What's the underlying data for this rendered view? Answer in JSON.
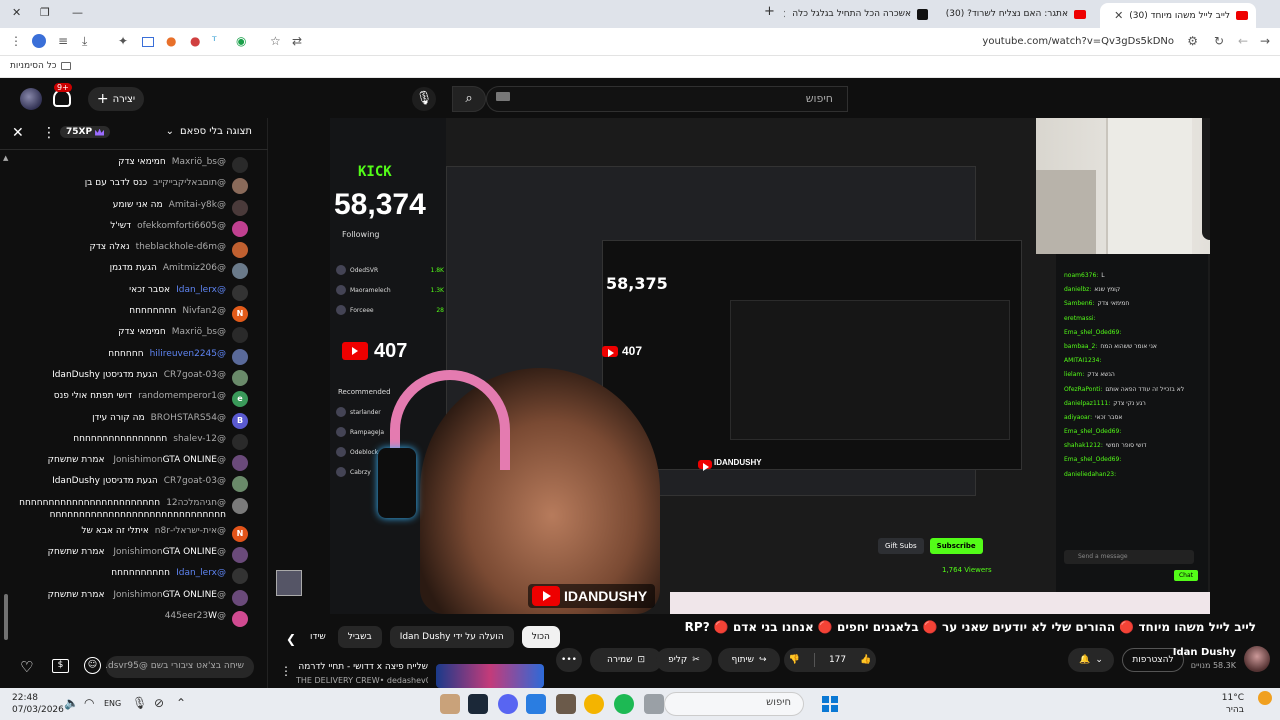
{
  "browser": {
    "tabs": [
      {
        "title": "לייב לייל משהו מיוחד (30)",
        "active": true
      },
      {
        "title": "אתגר: האם נצליח לשרוד? (30)",
        "active": false
      },
      {
        "title": "אשכרה הכל התחיל בגלגל כלה",
        "active": false
      }
    ],
    "new_tab": "+",
    "url": "youtube.com/watch?v=Qv3gDs5kDNo",
    "bookmarks_label": "כל הסימניות"
  },
  "masthead": {
    "create_label": "יצירה",
    "notif_count": "9+",
    "search_placeholder": "חיפוש"
  },
  "chat": {
    "mode_label": "תצוגה בלי ספאם",
    "xp_label": "75XP",
    "input_placeholder": "שיחה בצ'אט ציבורי בשם @dsvr95...",
    "messages": [
      {
        "author": "@Maxriö_bs",
        "text": "חמימאי צדק",
        "av": "#2a2a2a",
        "initial": "",
        "mod": false
      },
      {
        "author": "@תוםבאליקבייקייב",
        "text": "כנס לדבר עם בן",
        "av": "#8a6a5a",
        "initial": "",
        "mod": false
      },
      {
        "author": "@Amitai-y8k",
        "text": "מה אני שומע",
        "av": "#4a3a3a",
        "initial": "",
        "mod": false
      },
      {
        "author": "@ofekkomforti6605",
        "text": "דשי'ל",
        "av": "#c04090",
        "initial": "",
        "mod": false
      },
      {
        "author": "@theblackhole-d6m",
        "text": "נאלה צדק",
        "av": "#c06030",
        "initial": "",
        "mod": false
      },
      {
        "author": "@Amitmiz206",
        "text": "הגעת מדגמן",
        "av": "#6a7a8a",
        "initial": "",
        "mod": false
      },
      {
        "author": "@Idan_lerx",
        "text": "אסבר זכאי",
        "av": "#333",
        "initial": "",
        "mod": true
      },
      {
        "author": "@Nivfan2",
        "text": "חחחחחחחח",
        "av": "#e25b1a",
        "initial": "N",
        "mod": false
      },
      {
        "author": "@Maxriö_bs",
        "text": "חמימאי צדק",
        "av": "#2a2a2a",
        "initial": "",
        "mod": false
      },
      {
        "author": "@hilireuven2245",
        "text": "חחחחחח",
        "av": "#5a6a9a",
        "initial": "",
        "mod": true
      },
      {
        "author": "@CR7goat-03",
        "text": "הגעת מדגיסטן IdanDushy",
        "av": "#6a8a6a",
        "initial": "",
        "mod": false
      },
      {
        "author": "@randomemperor1",
        "text": "דושי תפתח אולי פנס",
        "av": "#3a9a5a",
        "initial": "e",
        "mod": false
      },
      {
        "author": "@BROHSTARS54",
        "text": "מה קורה עידן",
        "av": "#5a5ad0",
        "initial": "B",
        "mod": false
      },
      {
        "author": "@shalev-12",
        "text": "חחחחחחחחחחחחחחחח",
        "av": "#2a2a2a",
        "initial": "",
        "mod": false
      },
      {
        "author": "@Jonishimon",
        "text": "GTA ONLINE אמרת שתשחק",
        "av": "#6a4a7a",
        "initial": "",
        "mod": false
      },
      {
        "author": "@CR7goat-03",
        "text": "הגעת מדגיסטן IdanDushy",
        "av": "#6a8a6a",
        "initial": "",
        "mod": false
      },
      {
        "author": "@חגיהמלכה12",
        "text": "חחחחחחחחחחחחחחחחחחחחחחחחחחחחחחחחחחחחחחחחחחחחחחחחחחחחחח",
        "av": "#7a7a7a",
        "initial": "",
        "mod": false
      },
      {
        "author": "@אית-ישראלי-n8r",
        "text": "איתלי זה אבא של",
        "av": "#e2541a",
        "initial": "N",
        "mod": false
      },
      {
        "author": "@Jonishimon",
        "text": "GTA ONLINE אמרת שתשחק",
        "av": "#6a4a7a",
        "initial": "",
        "mod": false
      },
      {
        "author": "@Idan_lerx",
        "text": "חחחחחחחחחח",
        "av": "#333",
        "initial": "",
        "mod": true
      },
      {
        "author": "@Jonishimon",
        "text": "GTA ONLINE אמרת שתשחק",
        "av": "#6a4a7a",
        "initial": "",
        "mod": false
      },
      {
        "author": "@445eer23",
        "text": "W",
        "av": "#d04a90",
        "initial": "",
        "mod": false
      }
    ]
  },
  "stream": {
    "kick_logo": "KICK",
    "big_count": "58,374",
    "inner_count": "58,375",
    "yt_badge_count": "407",
    "yt_badge_count_inner": "407",
    "following_label": "Following",
    "follow_rows": [
      {
        "name": "OdedSVR",
        "count": "1.8K"
      },
      {
        "name": "Maoramelech",
        "count": "1.3K"
      },
      {
        "name": "Forceee",
        "count": "28"
      }
    ],
    "recommended_label": "Recommended",
    "rec_rows": [
      "starlander",
      "RampageJa",
      "Odeblock",
      "Cabrzy"
    ],
    "kick_chat": [
      {
        "u": "noam6376:",
        "t": "L"
      },
      {
        "u": "danielbz:",
        "t": "קומץ שנא"
      },
      {
        "u": "Samben6:",
        "t": "חמימאי צדק"
      },
      {
        "u": "eretmassi:",
        "t": ""
      },
      {
        "u": "Ema_shel_Oded69:",
        "t": ""
      },
      {
        "u": "bambaa_2:",
        "t": "אני אומר ששהוא המח"
      },
      {
        "u": "AMITAI1234:",
        "t": ""
      },
      {
        "u": "lielam:",
        "t": "הנשא צדק"
      },
      {
        "u": "OfezRaPonti:",
        "t": "לא בזכייל זה עודד הפאה אותם"
      },
      {
        "u": "danielpaz1111:",
        "t": "רגע נקי צדק"
      },
      {
        "u": "adiyaoar:",
        "t": "אסבר זכאי"
      },
      {
        "u": "Ema_shel_Oded69:",
        "t": ""
      },
      {
        "u": "shahak1212:",
        "t": "דושי סופר חמשי"
      },
      {
        "u": "Ema_shel_Oded69:",
        "t": ""
      },
      {
        "u": "danieliedahan23:",
        "t": ""
      }
    ],
    "kick_chat_placeholder": "Send a message",
    "kick_chat_button": "Chat",
    "subscribe_label": "Subscribe",
    "gift_label": "Gift Subs",
    "viewers_label": "1,764 Viewers",
    "watermark": "IDANDUSHY",
    "watermark_inner": "IDANDUSHY"
  },
  "below": {
    "chips": [
      "הכול",
      "הועלה על ידי Idan Dushy",
      "בשביל",
      "שידו"
    ],
    "next_title": "שלייח פיצה x דדושי - תחיי לדרמה 2",
    "next_channel": "THE DELIVERY CREW• dedashev02",
    "video_title": "לייב לייל משהו מיוחד 🔴 ההורים שלי לא יודעים שאני ער 🔴 בלאגנים יחפים 🔴 אנחנו בני אדם 🔴 ?RP",
    "channel_name": "Idan Dushy",
    "subscribers": "58.3K מנויים",
    "join_label": "להצטרפות",
    "like_count": "177",
    "share_label": "שיתוף",
    "clip_label": "קליפ",
    "save_label": "שמירה"
  },
  "taskbar": {
    "time": "22:48",
    "date": "07/03/2026",
    "lang": "ENG",
    "search_label": "חיפוש",
    "temp": "11°C",
    "weather": "בהיר"
  }
}
